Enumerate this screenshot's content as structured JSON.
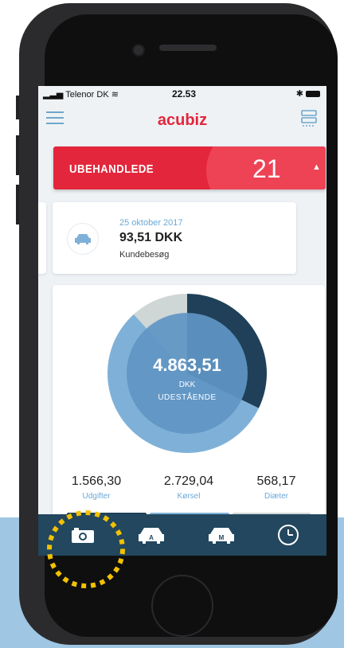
{
  "status_bar": {
    "carrier": "Telenor DK",
    "time": "22.53"
  },
  "app": {
    "brand": "acubiz"
  },
  "banner": {
    "label": "UBEHANDLEDE",
    "count": "21"
  },
  "expense": {
    "date": "25 oktober 2017",
    "amount": "93,51 DKK",
    "description": "Kundebesøg"
  },
  "summary": {
    "total": "4.863,51",
    "currency": "DKK",
    "label": "UDESTÅENDE",
    "stats": [
      {
        "value": "1.566,30",
        "label": "Udgifter"
      },
      {
        "value": "2.729,04",
        "label": "Kørsel"
      },
      {
        "value": "568,17",
        "label": "Diæter"
      }
    ]
  },
  "chart_data": {
    "type": "pie",
    "categories": [
      "Udgifter",
      "Kørsel",
      "Diæter"
    ],
    "values": [
      1566.3,
      2729.04,
      568.17
    ],
    "colors": [
      "#1f4058",
      "#7fb1d8",
      "#cfd6d6"
    ]
  },
  "tabs": [
    {
      "icon": "camera-icon"
    },
    {
      "icon": "car-a-icon",
      "badge": "A"
    },
    {
      "icon": "car-m-icon",
      "badge": "M"
    },
    {
      "icon": "clock-icon"
    }
  ],
  "colors": {
    "accent": "#e3263b",
    "navy": "#22475e",
    "highlight": "#f2c200"
  }
}
